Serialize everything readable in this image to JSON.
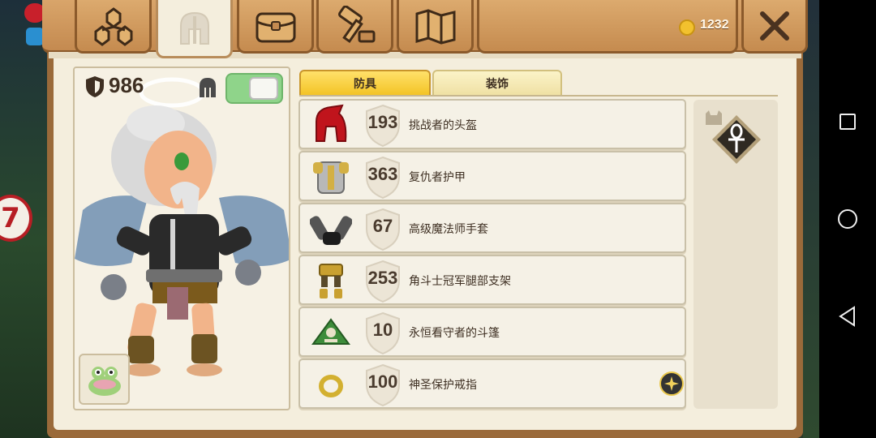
{
  "hud": {
    "badge_text": "7"
  },
  "currency": {
    "coins": "1232"
  },
  "categories": [
    {
      "name": "stats"
    },
    {
      "name": "armor"
    },
    {
      "name": "bag"
    },
    {
      "name": "crafting"
    },
    {
      "name": "map"
    }
  ],
  "character": {
    "armor_total": "986",
    "helmet_visible": true
  },
  "tabs": {
    "armor": "防具",
    "accessories": "装饰"
  },
  "items": [
    {
      "value": "193",
      "name": "挑战者的头盔",
      "icon": "red-helmet-icon"
    },
    {
      "value": "363",
      "name": "复仇者护甲",
      "icon": "chest-armor-icon"
    },
    {
      "value": "67",
      "name": "高级魔法师手套",
      "icon": "gloves-icon"
    },
    {
      "value": "253",
      "name": "角斗士冠军腿部支架",
      "icon": "leg-armor-icon"
    },
    {
      "value": "10",
      "name": "永恒看守者的斗篷",
      "icon": "cloak-icon"
    },
    {
      "value": "100",
      "name": "神圣保护戒指",
      "icon": "ring-icon",
      "special": true
    }
  ],
  "colors": {
    "accent_tab": "#f3c323",
    "toggle_on": "#8fd48a",
    "wood": "#c58b4f"
  }
}
